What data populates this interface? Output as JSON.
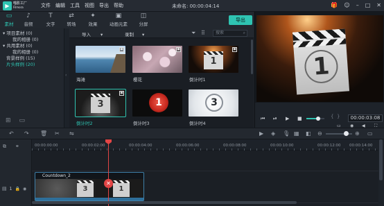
{
  "app": {
    "brand_line1": "喵影工厂",
    "brand_line2": "Filmora",
    "menu": [
      "文件",
      "编辑",
      "工具",
      "视图",
      "导出",
      "帮助"
    ],
    "window_title": "未命名: 00:00:04:14"
  },
  "toolbar": {
    "tabs": [
      {
        "label": "素材",
        "icon": "folder-icon",
        "active": true
      },
      {
        "label": "音频",
        "icon": "music-note-icon"
      },
      {
        "label": "文字",
        "icon": "text-icon"
      },
      {
        "label": "转场",
        "icon": "transition-icon"
      },
      {
        "label": "效果",
        "icon": "effects-icon"
      },
      {
        "label": "动画元素",
        "icon": "image-icon"
      },
      {
        "label": "分屏",
        "icon": "split-screen-icon"
      }
    ],
    "export_label": "导出"
  },
  "library": {
    "tree": [
      {
        "label": "项目素材 (0)",
        "indent": 0
      },
      {
        "label": "我的相册 (0)",
        "indent": 1
      },
      {
        "label": "共用素材 (0)",
        "indent": 0
      },
      {
        "label": "我的相册 (0)",
        "indent": 1
      },
      {
        "label": "背景样例 (15)",
        "indent": 0
      },
      {
        "label": "片头样例 (20)",
        "indent": 0,
        "selected": true
      }
    ],
    "import_label": "导入",
    "record_label": "录制",
    "search_placeholder": "搜索",
    "items": [
      {
        "caption": "海滩",
        "scene": "beach"
      },
      {
        "caption": "樱花",
        "scene": "blossom"
      },
      {
        "caption": "倒计时1",
        "scene": "countdown-dark"
      },
      {
        "caption": "倒计时2",
        "scene": "countdown-board",
        "selected": true
      },
      {
        "caption": "倒计时3",
        "scene": "countdown-red"
      },
      {
        "caption": "倒计时4",
        "scene": "countdown-light"
      }
    ]
  },
  "preview": {
    "frame_digit": "1",
    "timecode": "00:00:03:08",
    "volume_level": 0.65,
    "mark_in": "{",
    "mark_out": "}"
  },
  "timeline": {
    "ruler": [
      "00:00:00:00",
      "00:00:02:00",
      "00:00:04:00",
      "00:00:06:00",
      "00:00:08:00",
      "00:00:10:00",
      "00:00:12:00",
      "00:00:14:00"
    ],
    "clip_name": "Countdown_2",
    "track_number": "1",
    "zoom_level": 0.75
  },
  "colors": {
    "accent": "#2fc4b2",
    "playhead": "#e24545",
    "background": "#1d2229"
  }
}
